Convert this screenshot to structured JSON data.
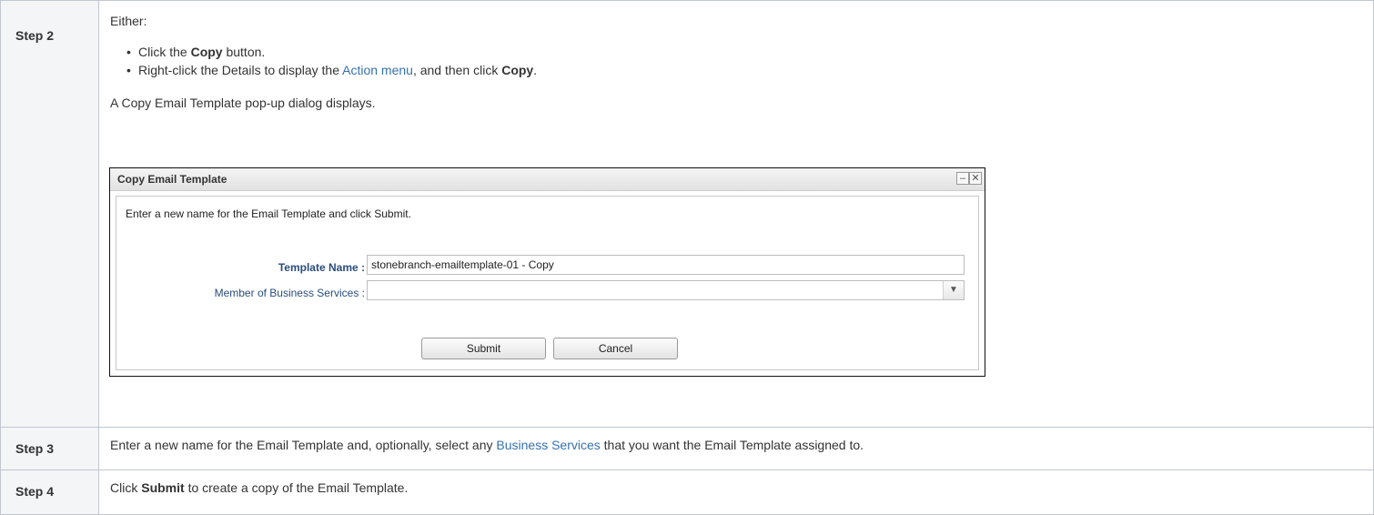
{
  "steps": [
    {
      "label": "Step 2",
      "intro": "Either:",
      "bullets": [
        {
          "pre": "Click the ",
          "bold": "Copy",
          "post": " button."
        },
        {
          "pre": "Right-click the Details to display the ",
          "link": "Action menu",
          "mid": ", and then click ",
          "bold": "Copy",
          "post": "."
        }
      ],
      "result": "A Copy Email Template pop-up dialog displays."
    },
    {
      "label": "Step 3",
      "pre": "Enter a new name for the Email Template and, optionally, select any ",
      "link": "Business Services",
      "post": " that you want the Email Template assigned to."
    },
    {
      "label": "Step 4",
      "pre": "Click ",
      "bold": "Submit",
      "post": " to create a copy of the Email Template."
    }
  ],
  "dialog": {
    "title": "Copy Email Template",
    "minimize_glyph": "–",
    "close_glyph": "✕",
    "instruction": "Enter a new name for the Email Template and click Submit.",
    "template_name_label": "Template Name :",
    "template_name_value": "stonebranch-emailtemplate-01 - Copy",
    "business_services_label": "Member of Business Services :",
    "business_services_value": "",
    "dropdown_icon": "chevron-down-icon",
    "submit_label": "Submit",
    "cancel_label": "Cancel"
  },
  "colors": {
    "link": "#3572b0",
    "label_blue": "#2b4d7e",
    "header_cell_bg": "#f4f5f7",
    "border": "#c1c7d0"
  }
}
